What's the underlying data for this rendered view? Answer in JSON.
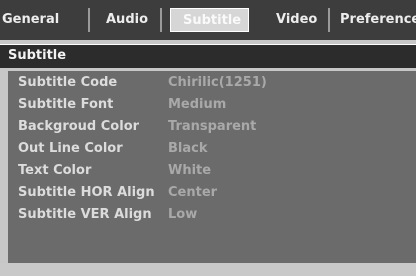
{
  "tabs": {
    "lead": "·",
    "general": "General",
    "audio": "Audio",
    "subtitle": "Subtitle",
    "video": "Video",
    "preferences": "Preferences"
  },
  "section": {
    "title": "Subtitle"
  },
  "settings": [
    {
      "label": "Subtitle Code",
      "value": "Chirilic(1251)"
    },
    {
      "label": "Subtitle Font",
      "value": "Medium"
    },
    {
      "label": "Backgroud Color",
      "value": "Transparent"
    },
    {
      "label": "Out Line Color",
      "value": "Black"
    },
    {
      "label": "Text Color",
      "value": "White"
    },
    {
      "label": "Subtitle HOR Align",
      "value": "Center"
    },
    {
      "label": "Subtitle VER Align",
      "value": "Low"
    }
  ]
}
